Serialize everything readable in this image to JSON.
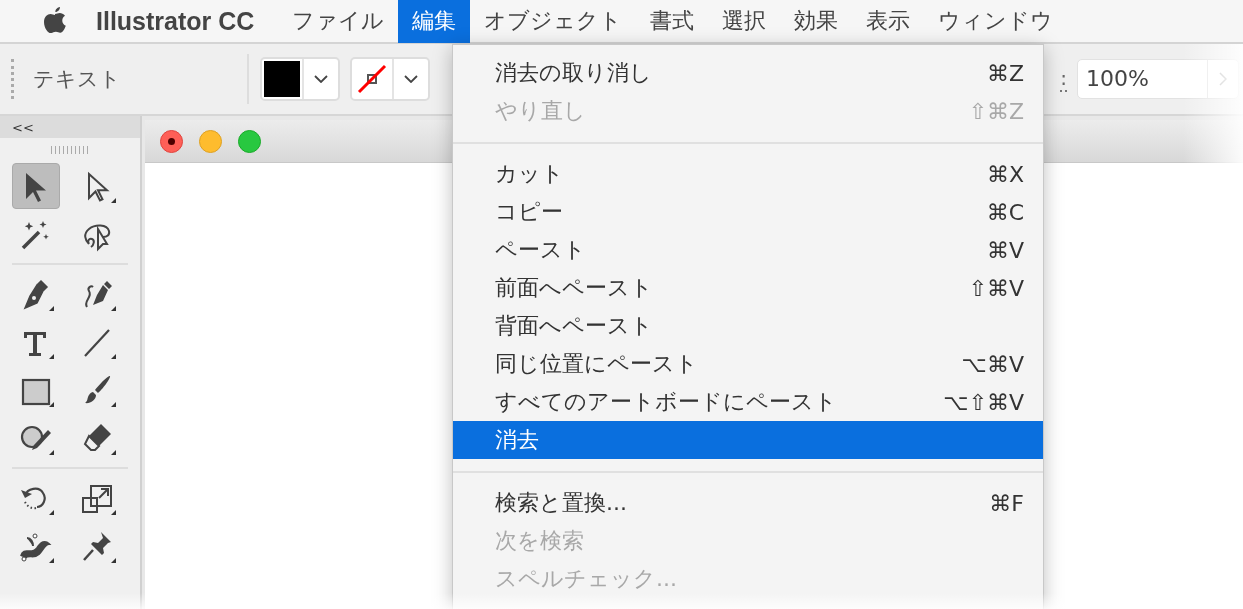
{
  "menubar": {
    "app_name": "Illustrator CC",
    "menus": [
      {
        "label": "ファイル",
        "selected": false
      },
      {
        "label": "編集",
        "selected": true
      },
      {
        "label": "オブジェクト",
        "selected": false
      },
      {
        "label": "書式",
        "selected": false
      },
      {
        "label": "選択",
        "selected": false
      },
      {
        "label": "効果",
        "selected": false
      },
      {
        "label": "表示",
        "selected": false
      },
      {
        "label": "ウィンドウ",
        "selected": false
      }
    ]
  },
  "control_bar": {
    "label": "テキスト",
    "zoom_label": ":",
    "zoom_value": "100%"
  },
  "tool_panel": {
    "collapse_label": "<<",
    "groups": [
      [
        {
          "kind": "selection",
          "selected": true
        },
        {
          "kind": "direct-selection",
          "selected": false
        },
        {
          "kind": "magic-wand",
          "selected": false
        },
        {
          "kind": "lasso",
          "selected": false
        }
      ],
      [
        {
          "kind": "pen",
          "selected": false
        },
        {
          "kind": "curvature",
          "selected": false
        },
        {
          "kind": "type",
          "selected": false
        },
        {
          "kind": "line",
          "selected": false
        },
        {
          "kind": "rectangle",
          "selected": false
        },
        {
          "kind": "brush",
          "selected": false
        },
        {
          "kind": "shaper",
          "selected": false
        },
        {
          "kind": "eraser",
          "selected": false
        }
      ],
      [
        {
          "kind": "rotate",
          "selected": false
        },
        {
          "kind": "scale",
          "selected": false
        },
        {
          "kind": "puppet",
          "selected": false
        },
        {
          "kind": "pin",
          "selected": false
        }
      ]
    ]
  },
  "edit_menu": {
    "sections": [
      [
        {
          "label": "消去の取り消し",
          "shortcut": "⌘Z",
          "disabled": false,
          "selected": false
        },
        {
          "label": "やり直し",
          "shortcut": "⇧⌘Z",
          "disabled": true,
          "selected": false
        }
      ],
      [
        {
          "label": "カット",
          "shortcut": "⌘X",
          "disabled": false,
          "selected": false
        },
        {
          "label": "コピー",
          "shortcut": "⌘C",
          "disabled": false,
          "selected": false
        },
        {
          "label": "ペースト",
          "shortcut": "⌘V",
          "disabled": false,
          "selected": false
        },
        {
          "label": "前面へペースト",
          "shortcut": "⇧⌘V",
          "disabled": false,
          "selected": false
        },
        {
          "label": "背面へペースト",
          "disabled": false,
          "selected": false
        },
        {
          "label": "同じ位置にペースト",
          "shortcut": "⌥⌘V",
          "disabled": false,
          "selected": false
        },
        {
          "label": "すべてのアートボードにペースト",
          "shortcut": "⌥⇧⌘V",
          "disabled": false,
          "selected": false
        },
        {
          "label": "消去",
          "disabled": false,
          "selected": true
        }
      ],
      [
        {
          "label": "検索と置換...",
          "shortcut": "⌘F",
          "disabled": false,
          "selected": false
        },
        {
          "label": "次を検索",
          "disabled": true,
          "selected": false
        },
        {
          "label": "スペルチェック...",
          "disabled": true,
          "selected": false
        }
      ]
    ]
  }
}
